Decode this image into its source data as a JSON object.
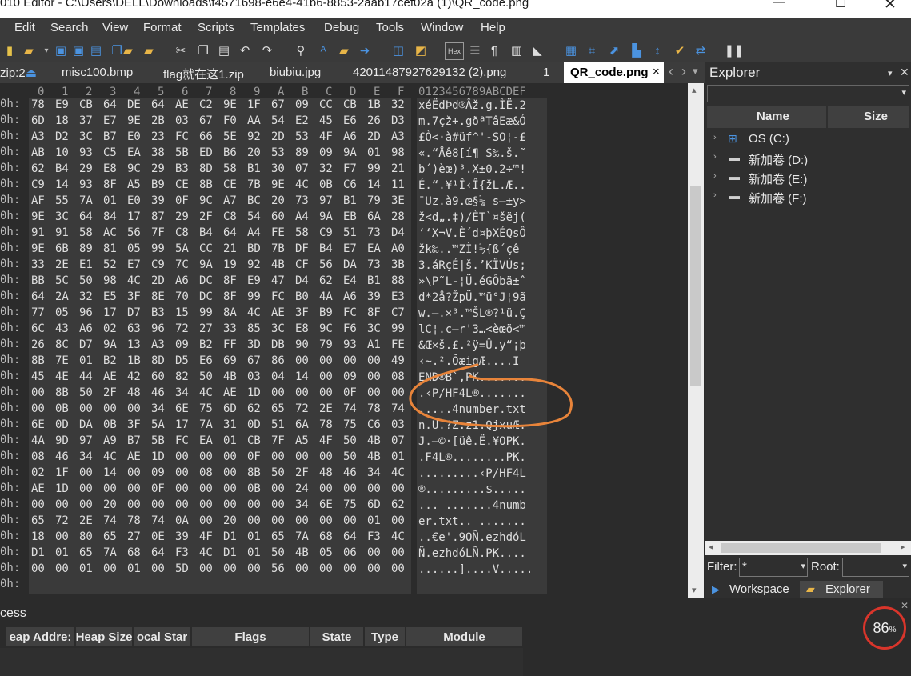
{
  "window": {
    "title": "010 Editor - C:\\Users\\DELL\\Downloads\\f4571698-e6e4-41b6-8853-2aab17cef02a (1)\\QR_code.png"
  },
  "menu": [
    "Edit",
    "Search",
    "View",
    "Format",
    "Scripts",
    "Templates",
    "Debug",
    "Tools",
    "Window",
    "Help"
  ],
  "toolbar": {
    "hex_label": "Hex"
  },
  "tabs": [
    {
      "label": "zip:2"
    },
    {
      "label": "misc100.bmp"
    },
    {
      "label": "flag就在这1.zip"
    },
    {
      "label": "biubiu.jpg"
    },
    {
      "label": "42011487927629132 (2).png"
    },
    {
      "label": "1"
    }
  ],
  "active_tab": {
    "label": "QR_code.png",
    "close": "×"
  },
  "tab_arrows": {
    "left": "‹",
    "right": "›",
    "menu": "▾"
  },
  "hex": {
    "column_headers": [
      "0",
      "1",
      "2",
      "3",
      "4",
      "5",
      "6",
      "7",
      "8",
      "9",
      "A",
      "B",
      "C",
      "D",
      "E",
      "F"
    ],
    "ascii_header": "0123456789ABCDEF",
    "rows": [
      {
        "addr": "0h:",
        "bytes": [
          "78",
          "E9",
          "CB",
          "64",
          "DE",
          "64",
          "AE",
          "C2",
          "9E",
          "1F",
          "67",
          "09",
          "CC",
          "CB",
          "1B",
          "32"
        ],
        "ascii": "xéËdÞd®Âž.g.ÌË.2"
      },
      {
        "addr": "0h:",
        "bytes": [
          "6D",
          "18",
          "37",
          "E7",
          "9E",
          "2B",
          "03",
          "67",
          "F0",
          "AA",
          "54",
          "E2",
          "45",
          "E6",
          "26",
          "D3"
        ],
        "ascii": "m.7çž+.gðªTâEæ&Ó"
      },
      {
        "addr": "0h:",
        "bytes": [
          "A3",
          "D2",
          "3C",
          "B7",
          "E0",
          "23",
          "FC",
          "66",
          "5E",
          "92",
          "2D",
          "53",
          "4F",
          "A6",
          "2D",
          "A3"
        ],
        "ascii": "£Ò<·à#üf^'-SO¦-£"
      },
      {
        "addr": "0h:",
        "bytes": [
          "AB",
          "10",
          "93",
          "C5",
          "EA",
          "38",
          "5B",
          "ED",
          "B6",
          "20",
          "53",
          "89",
          "09",
          "9A",
          "01",
          "98"
        ],
        "ascii": "«.“Åê8[í¶ S‰.š.˜"
      },
      {
        "addr": "0h:",
        "bytes": [
          "62",
          "B4",
          "29",
          "E8",
          "9C",
          "29",
          "B3",
          "8D",
          "58",
          "B1",
          "30",
          "07",
          "32",
          "F7",
          "99",
          "21"
        ],
        "ascii": "b´)èœ)³.X±0.2÷™!"
      },
      {
        "addr": "0h:",
        "bytes": [
          "C9",
          "14",
          "93",
          "8F",
          "A5",
          "B9",
          "CE",
          "8B",
          "CE",
          "7B",
          "9E",
          "4C",
          "0B",
          "C6",
          "14",
          "11"
        ],
        "ascii": "É.“.¥¹Î‹Î{žL.Æ.."
      },
      {
        "addr": "0h:",
        "bytes": [
          "AF",
          "55",
          "7A",
          "01",
          "E0",
          "39",
          "0F",
          "9C",
          "A7",
          "BC",
          "20",
          "73",
          "97",
          "B1",
          "79",
          "3E"
        ],
        "ascii": "¯Uz.à9.œ§¼ s—±y>"
      },
      {
        "addr": "0h:",
        "bytes": [
          "9E",
          "3C",
          "64",
          "84",
          "17",
          "87",
          "29",
          "2F",
          "C8",
          "54",
          "60",
          "A4",
          "9A",
          "EB",
          "6A",
          "28"
        ],
        "ascii": "ž<d„.‡)/ÈT`¤šëj("
      },
      {
        "addr": "0h:",
        "bytes": [
          "91",
          "91",
          "58",
          "AC",
          "56",
          "7F",
          "C8",
          "B4",
          "64",
          "A4",
          "FE",
          "58",
          "C9",
          "51",
          "73",
          "D4"
        ],
        "ascii": "‘‘X¬V.È´d¤þXÉQsÔ"
      },
      {
        "addr": "0h:",
        "bytes": [
          "9E",
          "6B",
          "89",
          "81",
          "05",
          "99",
          "5A",
          "CC",
          "21",
          "BD",
          "7B",
          "DF",
          "B4",
          "E7",
          "EA",
          "A0"
        ],
        "ascii": "žk‰..™ZÌ!½{ß´çê "
      },
      {
        "addr": "0h:",
        "bytes": [
          "33",
          "2E",
          "E1",
          "52",
          "E7",
          "C9",
          "7C",
          "9A",
          "19",
          "92",
          "4B",
          "CF",
          "56",
          "DA",
          "73",
          "3B"
        ],
        "ascii": "3.áRçÉ|š.’KÏVÚs;"
      },
      {
        "addr": "0h:",
        "bytes": [
          "BB",
          "5C",
          "50",
          "98",
          "4C",
          "2D",
          "A6",
          "DC",
          "8F",
          "E9",
          "47",
          "D4",
          "62",
          "E4",
          "B1",
          "88"
        ],
        "ascii": "»\\P˜L-¦Ü.éGÔbä±ˆ"
      },
      {
        "addr": "0h:",
        "bytes": [
          "64",
          "2A",
          "32",
          "E5",
          "3F",
          "8E",
          "70",
          "DC",
          "8F",
          "99",
          "FC",
          "B0",
          "4A",
          "A6",
          "39",
          "E3"
        ],
        "ascii": "d*2å?ŽpÜ.™ü°J¦9ã"
      },
      {
        "addr": "0h:",
        "bytes": [
          "77",
          "05",
          "96",
          "17",
          "D7",
          "B3",
          "15",
          "99",
          "8A",
          "4C",
          "AE",
          "3F",
          "B9",
          "FC",
          "8F",
          "C7"
        ],
        "ascii": "w.–.×³.™ŠL®?¹ü.Ç"
      },
      {
        "addr": "0h:",
        "bytes": [
          "6C",
          "43",
          "A6",
          "02",
          "63",
          "96",
          "72",
          "27",
          "33",
          "85",
          "3C",
          "E8",
          "9C",
          "F6",
          "3C",
          "99"
        ],
        "ascii": "lC¦.c–r'3…<èœö<™"
      },
      {
        "addr": "0h:",
        "bytes": [
          "26",
          "8C",
          "D7",
          "9A",
          "13",
          "A3",
          "09",
          "B2",
          "FF",
          "3D",
          "DB",
          "90",
          "79",
          "93",
          "A1",
          "FE"
        ],
        "ascii": "&Œ×š.£.²ÿ=Û.y“¡þ"
      },
      {
        "addr": "0h:",
        "bytes": [
          "8B",
          "7E",
          "01",
          "B2",
          "1B",
          "8D",
          "D5",
          "E6",
          "69",
          "67",
          "86",
          "00",
          "00",
          "00",
          "00",
          "49"
        ],
        "ascii": "‹~.².ÕæigÆ....I"
      },
      {
        "addr": "0h:",
        "bytes": [
          "45",
          "4E",
          "44",
          "AE",
          "42",
          "60",
          "82",
          "50",
          "4B",
          "03",
          "04",
          "14",
          "00",
          "09",
          "00",
          "08"
        ],
        "ascii": "END®B`‚PK......."
      },
      {
        "addr": "0h:",
        "bytes": [
          "00",
          "8B",
          "50",
          "2F",
          "48",
          "46",
          "34",
          "4C",
          "AE",
          "1D",
          "00",
          "00",
          "00",
          "0F",
          "00",
          "00"
        ],
        "ascii": ".‹P/HF4L®......."
      },
      {
        "addr": "0h:",
        "bytes": [
          "00",
          "0B",
          "00",
          "00",
          "00",
          "34",
          "6E",
          "75",
          "6D",
          "62",
          "65",
          "72",
          "2E",
          "74",
          "78",
          "74"
        ],
        "ascii": ".....4number.txt"
      },
      {
        "addr": "0h:",
        "bytes": [
          "6E",
          "0D",
          "DA",
          "0B",
          "3F",
          "5A",
          "17",
          "7A",
          "31",
          "0D",
          "51",
          "6A",
          "78",
          "75",
          "C6",
          "03"
        ],
        "ascii": "n.Ú.?Z.z1.QjxuÆ."
      },
      {
        "addr": "0h:",
        "bytes": [
          "4A",
          "9D",
          "97",
          "A9",
          "B7",
          "5B",
          "FC",
          "EA",
          "01",
          "CB",
          "7F",
          "A5",
          "4F",
          "50",
          "4B",
          "07"
        ],
        "ascii": "J.—©·[üê.Ë.¥OPK."
      },
      {
        "addr": "0h:",
        "bytes": [
          "08",
          "46",
          "34",
          "4C",
          "AE",
          "1D",
          "00",
          "00",
          "00",
          "0F",
          "00",
          "00",
          "00",
          "50",
          "4B",
          "01"
        ],
        "ascii": ".F4L®........PK."
      },
      {
        "addr": "0h:",
        "bytes": [
          "02",
          "1F",
          "00",
          "14",
          "00",
          "09",
          "00",
          "08",
          "00",
          "8B",
          "50",
          "2F",
          "48",
          "46",
          "34",
          "4C"
        ],
        "ascii": ".........‹P/HF4L"
      },
      {
        "addr": "0h:",
        "bytes": [
          "AE",
          "1D",
          "00",
          "00",
          "00",
          "0F",
          "00",
          "00",
          "00",
          "0B",
          "00",
          "24",
          "00",
          "00",
          "00",
          "00"
        ],
        "ascii": "®.........$....."
      },
      {
        "addr": "0h:",
        "bytes": [
          "00",
          "00",
          "00",
          "20",
          "00",
          "00",
          "00",
          "00",
          "00",
          "00",
          "00",
          "34",
          "6E",
          "75",
          "6D",
          "62"
        ],
        "ascii": "... .......4numb"
      },
      {
        "addr": "0h:",
        "bytes": [
          "65",
          "72",
          "2E",
          "74",
          "78",
          "74",
          "0A",
          "00",
          "20",
          "00",
          "00",
          "00",
          "00",
          "00",
          "01",
          "00"
        ],
        "ascii": "er.txt.. ......."
      },
      {
        "addr": "0h:",
        "bytes": [
          "18",
          "00",
          "80",
          "65",
          "27",
          "0E",
          "39",
          "4F",
          "D1",
          "01",
          "65",
          "7A",
          "68",
          "64",
          "F3",
          "4C"
        ],
        "ascii": "..€e'.9OÑ.ezhdóL"
      },
      {
        "addr": "0h:",
        "bytes": [
          "D1",
          "01",
          "65",
          "7A",
          "68",
          "64",
          "F3",
          "4C",
          "D1",
          "01",
          "50",
          "4B",
          "05",
          "06",
          "00",
          "00"
        ],
        "ascii": "Ñ.ezhdóLÑ.PK...."
      },
      {
        "addr": "0h:",
        "bytes": [
          "00",
          "00",
          "01",
          "00",
          "01",
          "00",
          "5D",
          "00",
          "00",
          "00",
          "56",
          "00",
          "00",
          "00",
          "00",
          "00"
        ],
        "ascii": "......]....V....."
      },
      {
        "addr": "0h:",
        "bytes": [],
        "ascii": ""
      }
    ]
  },
  "explorer": {
    "title": "Explorer",
    "columns": {
      "name": "Name",
      "size": "Size"
    },
    "drives": [
      {
        "label": "OS (C:)"
      },
      {
        "label": "新加卷 (D:)"
      },
      {
        "label": "新加卷 (E:)"
      },
      {
        "label": "新加卷 (F:)"
      }
    ],
    "filter_label": "Filter:",
    "filter_value": "*",
    "root_label": "Root:",
    "root_value": "",
    "bottom_tabs": {
      "workspace": "Workspace",
      "explorer": "Explorer"
    }
  },
  "process": {
    "title": "cess",
    "columns": [
      "eap Addre:",
      "Heap Size",
      "ocal Star",
      "Flags",
      "State",
      "Type",
      "Module"
    ]
  },
  "overlay": {
    "percent_value": "86",
    "percent_sign": "%"
  },
  "colors": {
    "annotation": "#e8843a",
    "badge_ring": "#d9352b",
    "active_tab_bg": "#ffffff",
    "accent_blue": "#2f74c9"
  }
}
